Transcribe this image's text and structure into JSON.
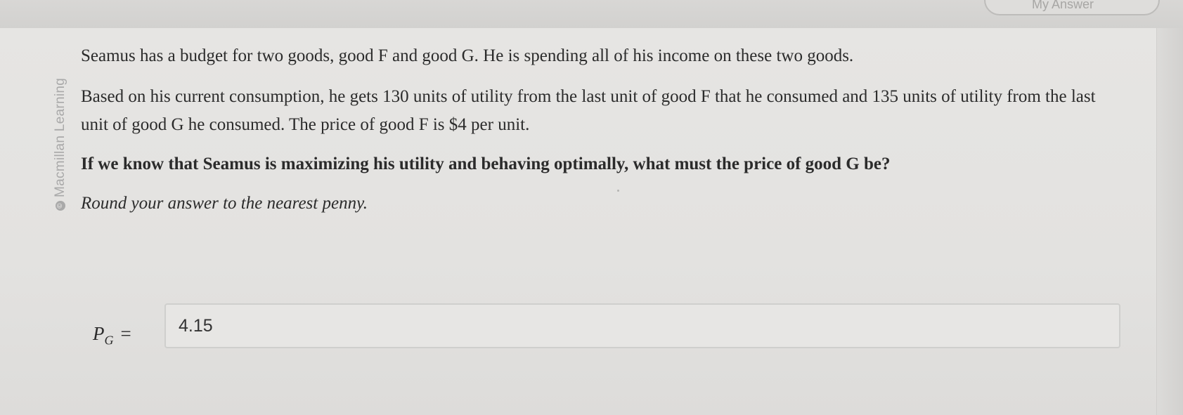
{
  "header": {
    "tab_label": "My Answer"
  },
  "watermark": {
    "text": "Macmillan Learning",
    "icon": "copyright-icon"
  },
  "question": {
    "paragraph1": "Seamus has a budget for two goods, good F and good G. He is spending all of his income on these two goods.",
    "paragraph2": "Based on his current consumption, he gets 130 units of utility from the last unit of good F that he consumed and 135 units of utility from the last unit of good G he consumed. The price of good F is $4 per unit.",
    "paragraph3": "If we know that Seamus is maximizing his utility and behaving optimally, what must the price of good G be?",
    "paragraph4": "Round your answer to the nearest penny."
  },
  "answer": {
    "label_main": "P",
    "label_sub": "G",
    "label_eq": "=",
    "value": "4.15"
  }
}
